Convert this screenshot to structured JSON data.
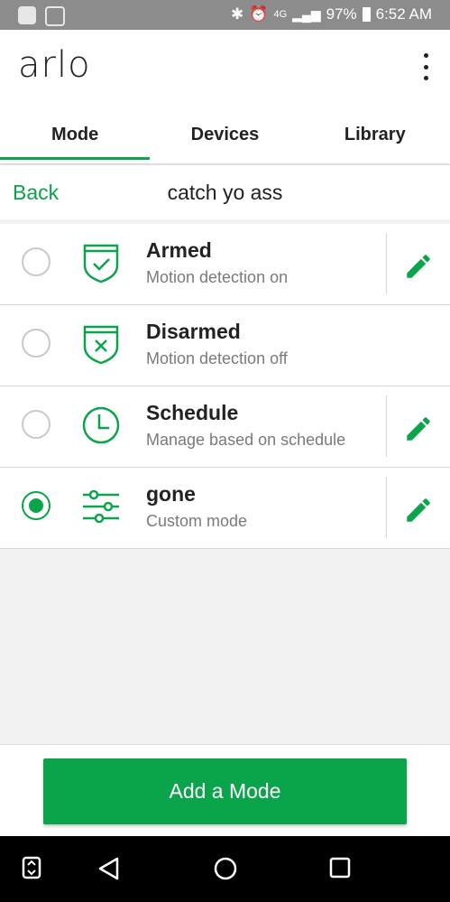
{
  "status_bar": {
    "network": "4G",
    "battery": "97%",
    "time": "6:52 AM"
  },
  "app": {
    "logo": "arlo",
    "menu_icon": "more-vert-icon"
  },
  "tabs": [
    {
      "label": "Mode",
      "active": true
    },
    {
      "label": "Devices",
      "active": false
    },
    {
      "label": "Library",
      "active": false
    }
  ],
  "nav": {
    "back_label": "Back",
    "title": "catch yo ass"
  },
  "modes": [
    {
      "name": "Armed",
      "description": "Motion detection on",
      "icon": "shield-check-icon",
      "selected": false,
      "editable": true
    },
    {
      "name": "Disarmed",
      "description": "Motion detection off",
      "icon": "shield-x-icon",
      "selected": false,
      "editable": false
    },
    {
      "name": "Schedule",
      "description": "Manage based on schedule",
      "icon": "clock-icon",
      "selected": false,
      "editable": true
    },
    {
      "name": "gone",
      "description": "Custom mode",
      "icon": "sliders-icon",
      "selected": true,
      "editable": true
    }
  ],
  "footer": {
    "add_mode_label": "Add a Mode"
  },
  "colors": {
    "accent": "#0aa54a",
    "status_bar": "#8c8c8c"
  }
}
